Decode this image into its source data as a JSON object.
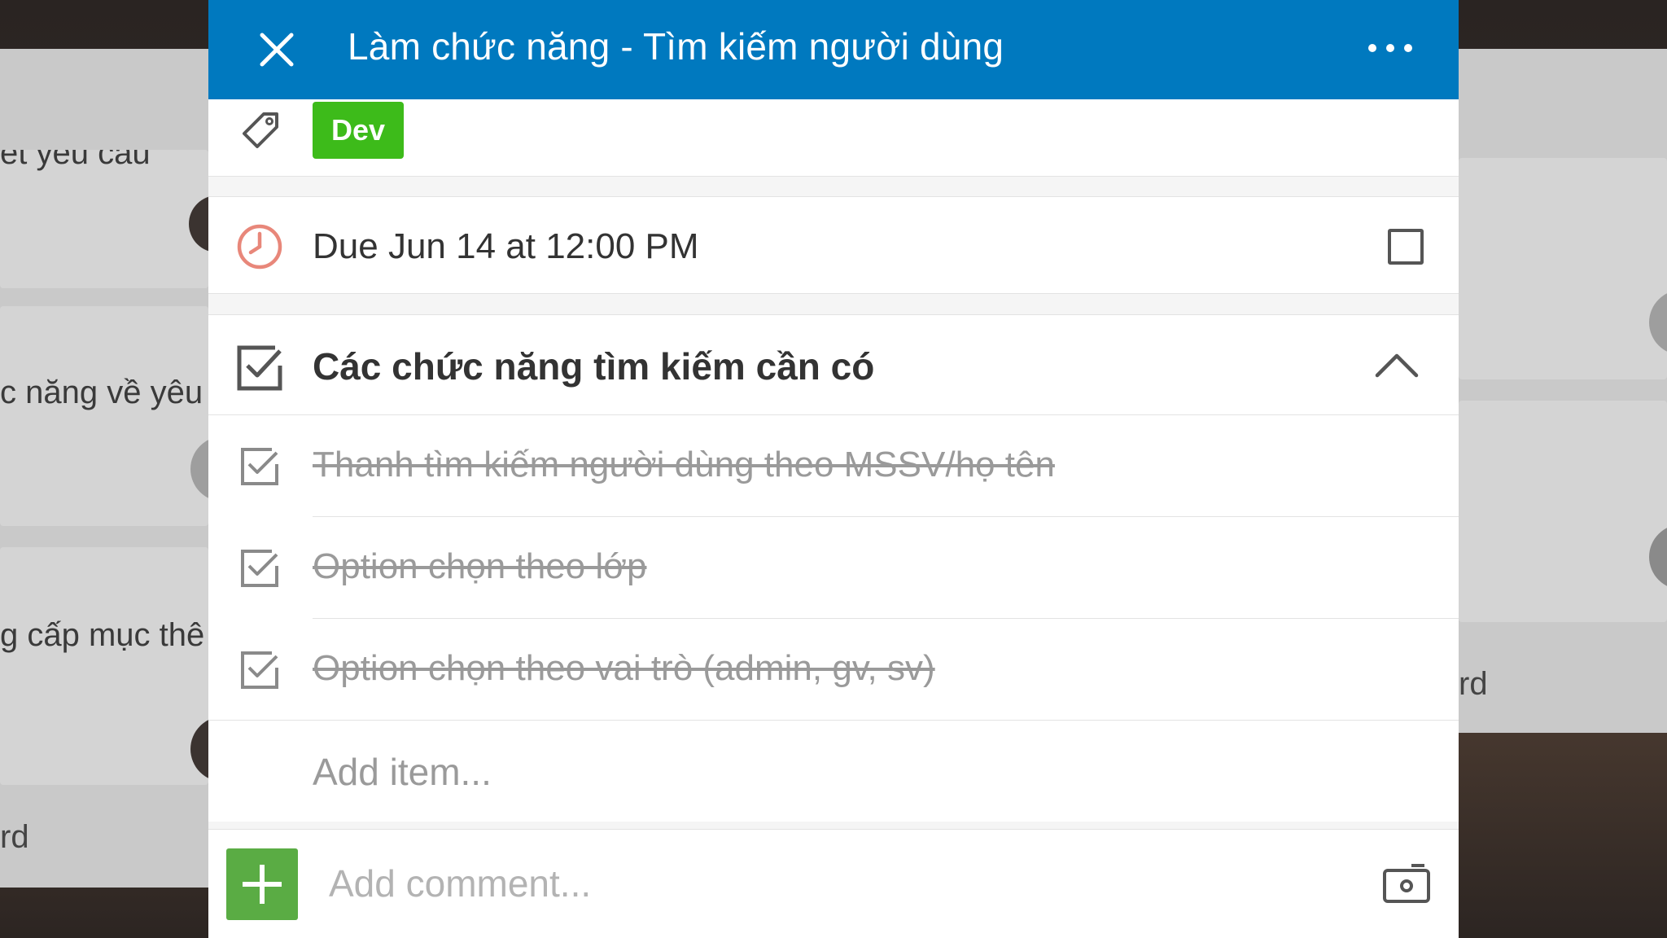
{
  "background": {
    "left_cards": [
      "ết yêu cầu",
      "c năng về yêu",
      "g cấp mục thê",
      "rd"
    ],
    "right_cards": [
      "rd"
    ]
  },
  "header": {
    "title": "Làm chức năng - Tìm kiếm người dùng",
    "close_icon": "close-icon",
    "more_icon": "more-icon",
    "color": "#0079bf"
  },
  "labels": {
    "items": [
      {
        "text": "Dev",
        "color": "#3dbb1a"
      }
    ]
  },
  "due": {
    "text": "Due Jun 14 at 12:00 PM",
    "icon": "clock-icon",
    "icon_color": "#e8877a",
    "completed": false
  },
  "checklist": {
    "title": "Các chức năng tìm kiếm cần có",
    "items": [
      {
        "text": "Thanh tìm kiếm người dùng theo MSSV/họ tên",
        "checked": true
      },
      {
        "text": "Option chọn theo lớp",
        "checked": true
      },
      {
        "text": "Option chọn theo vai trò (admin, gv, sv)",
        "checked": true
      }
    ],
    "add_item_placeholder": "Add item..."
  },
  "comment": {
    "placeholder": "Add comment...",
    "add_icon": "plus-icon",
    "camera_icon": "camera-icon"
  }
}
